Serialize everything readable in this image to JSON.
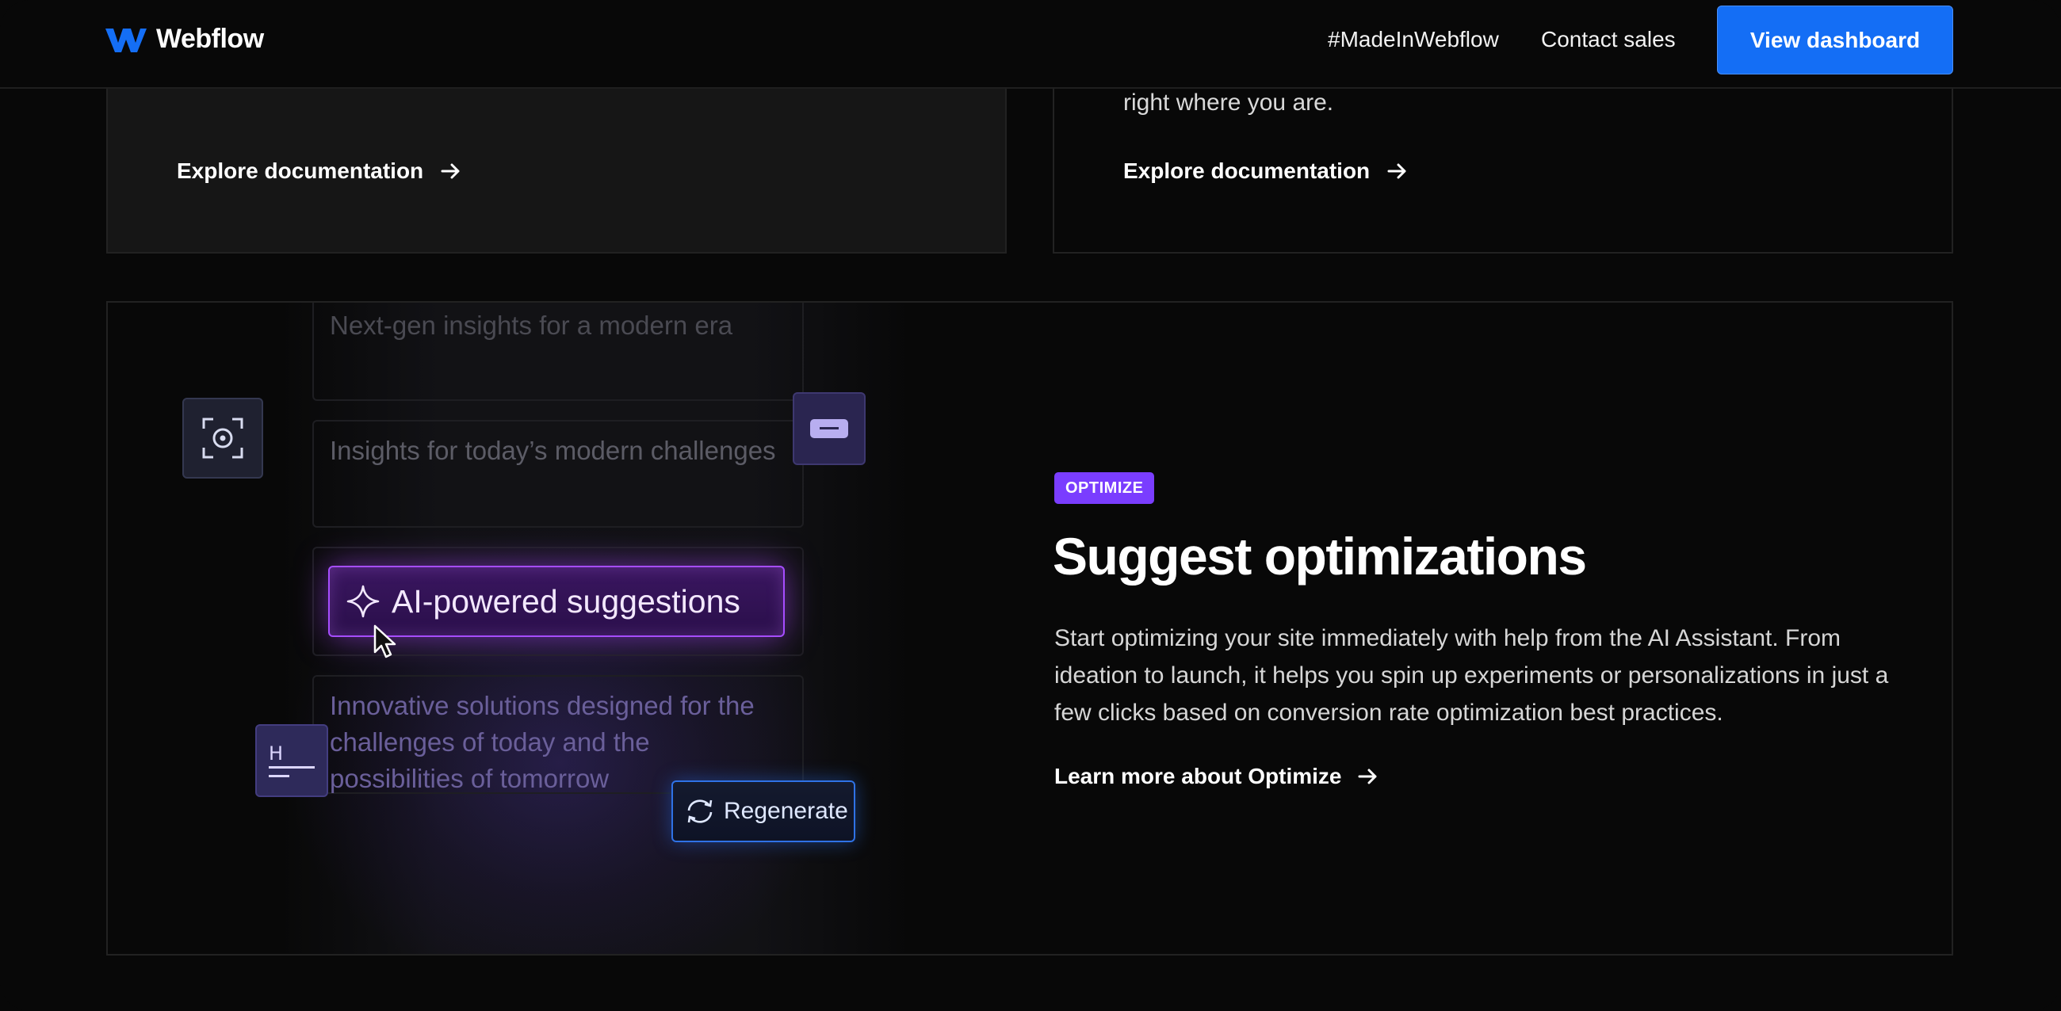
{
  "nav": {
    "brand": "Webflow",
    "links": [
      "#MadeInWebflow",
      "Contact sales"
    ],
    "cta": "View dashboard"
  },
  "top_cards": {
    "right_text": "right where you are.",
    "left_link": "Explore documentation",
    "right_link": "Explore documentation"
  },
  "illustration": {
    "cards": [
      "Next-gen insights for a modern era",
      "Insights for today’s modern challenges",
      "AI-powered suggestions",
      "Innovative solutions designed for the challenges of today and the possibilities of tomorrow"
    ],
    "regenerate": "Regenerate",
    "heading_icon_letter": "H",
    "icons": [
      "focus-icon",
      "minus-icon",
      "heading-icon",
      "sparkle-icon",
      "refresh-icon",
      "cursor-icon"
    ]
  },
  "feature": {
    "badge": "OPTIMIZE",
    "title": "Suggest optimizations",
    "description": "Start optimizing your site immediately with help from the AI Assistant. From ideation to launch, it helps you spin up experiments or personalizations in just a few clicks based on conversion rate optimization best practices.",
    "link": "Learn more about Optimize"
  },
  "colors": {
    "background": "#080808",
    "cta": "#146ef5",
    "badge": "#7a3dff",
    "ai_border": "#a64dff",
    "regen_border": "#2f72e6"
  }
}
